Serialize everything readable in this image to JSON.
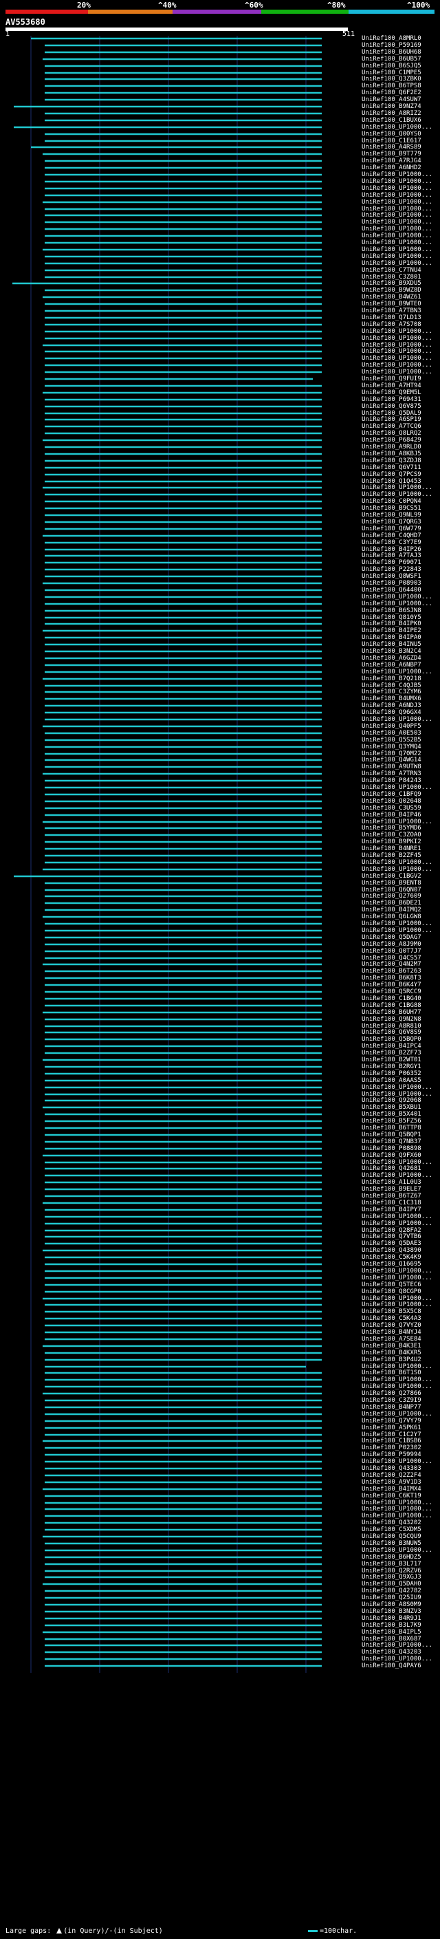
{
  "header": {
    "percent_labels": [
      "20%",
      "^40%",
      "^60%",
      "^80%",
      "^100%"
    ],
    "bar_colors": [
      "#e01818",
      "#e07818",
      "#9030c0",
      "#10b010",
      "#18b8d8"
    ]
  },
  "query": {
    "id": "AV553680",
    "start": "1",
    "end": "511"
  },
  "colors": {
    "hit_line": "#20c8d0",
    "grid": "#1c2e70",
    "background": "#000000"
  },
  "hits": [
    "UniRef100_A8MRL0",
    "UniRef100_P59169",
    "UniRef100_B6UH68",
    "UniRef100_B6UB57",
    "UniRef100_B6SJQ5",
    "UniRef100_C1MPE5",
    "UniRef100_Q3ZBK0",
    "UniRef100_B6TPS8",
    "UniRef100_Q6F2E2",
    "UniRef100_A4SUW7",
    "UniRef100_B9NZ74",
    "UniRef100_A8RIZ2",
    "UniRef100_C1BUX6",
    "UniRef100_UP1000...",
    "UniRef100_Q00YS0",
    "UniRef100_C1E617",
    "UniRef100_A4RS89",
    "UniRef100_B9T779",
    "UniRef100_A7RJG4",
    "UniRef100_A6NHD2",
    "UniRef100_UP1000...",
    "UniRef100_UP1000...",
    "UniRef100_UP1000...",
    "UniRef100_UP1000...",
    "UniRef100_UP1000...",
    "UniRef100_UP1000...",
    "UniRef100_UP1000...",
    "UniRef100_UP1000...",
    "UniRef100_UP1000...",
    "UniRef100_UP1000...",
    "UniRef100_UP1000...",
    "UniRef100_UP1000...",
    "UniRef100_UP1000...",
    "UniRef100_UP1000...",
    "UniRef100_C7TNU4",
    "UniRef100_C3Z801",
    "UniRef100_B9XDU5",
    "UniRef100_B9WZ8D",
    "UniRef100_B4WZ61",
    "UniRef100_B9WTE0",
    "UniRef100_A7TBN3",
    "UniRef100_Q7LD13",
    "UniRef100_A7S708",
    "UniRef100_UP1000...",
    "UniRef100_UP1000...",
    "UniRef100_UP1000...",
    "UniRef100_UP1000...",
    "UniRef100_UP1000...",
    "UniRef100_UP1000...",
    "UniRef100_UP1000...",
    "UniRef100_Q9FUI9",
    "UniRef100_A7HT94",
    "UniRef100_Q9EM5L",
    "UniRef100_P69431",
    "UniRef100_Q6V875",
    "UniRef100_Q5DAL9",
    "UniRef100_A6SP19",
    "UniRef100_A7TCQ6",
    "UniRef100_Q8LRQ2",
    "UniRef100_P68429",
    "UniRef100_A9RLD0",
    "UniRef100_A8KBJ5",
    "UniRef100_Q3ZDJ8",
    "UniRef100_Q6V711",
    "UniRef100_Q7PCS9",
    "UniRef100_Q1Q453",
    "UniRef100_UP1000...",
    "UniRef100_UP1000...",
    "UniRef100_C0PQN4",
    "UniRef100_B9CS51",
    "UniRef100_Q9NL99",
    "UniRef100_Q7QRG3",
    "UniRef100_Q6W779",
    "UniRef100_C4QHD7",
    "UniRef100_C3Y7E9",
    "UniRef100_B4IP26",
    "UniRef100_A7TAJ3",
    "UniRef100_P69071",
    "UniRef100_P22843",
    "UniRef100_Q8WSF1",
    "UniRef100_P08903",
    "UniRef100_Q64400",
    "UniRef100_UP1000...",
    "UniRef100_UP1000...",
    "UniRef100_B6SJN8",
    "UniRef100_Q810Y5",
    "UniRef100_B4IPK0",
    "UniRef100_B4IPE2",
    "UniRef100_B4IPA0",
    "UniRef100_B4INU5",
    "UniRef100_B3N2C4",
    "UniRef100_A6GZD4",
    "UniRef100_A6NBP7",
    "UniRef100_UP1000...",
    "UniRef100_B7Q218",
    "UniRef100_C4QJB5",
    "UniRef100_C3ZYM6",
    "UniRef100_B4UMX6",
    "UniRef100_A6NDJ3",
    "UniRef100_Q96GX4",
    "UniRef100_UP1000...",
    "UniRef100_Q40PF5",
    "UniRef100_A0E503",
    "UniRef100_Q5S2B5",
    "UniRef100_Q3YMQ4",
    "UniRef100_Q70M22",
    "UniRef100_Q4WG14",
    "UniRef100_A9UTW8",
    "UniRef100_A7TRN3",
    "UniRef100_P84243",
    "UniRef100_UP1000...",
    "UniRef100_C1BFQ9",
    "UniRef100_Q02648",
    "UniRef100_C3US59",
    "UniRef100_B4IP46",
    "UniRef100_UP1000...",
    "UniRef100_B5YMD6",
    "UniRef100_C3ZOA0",
    "UniRef100_B9PKI2",
    "UniRef100_B4NRE1",
    "UniRef100_B2ZF45",
    "UniRef100_UP1000...",
    "UniRef100_UP1000...",
    "UniRef100_C1BGV2",
    "UniRef100_B9ENT8",
    "UniRef100_Q6QN07",
    "UniRef100_Q27609",
    "UniRef100_B6DE21",
    "UniRef100_B4IMQ2",
    "UniRef100_Q6LGW8",
    "UniRef100_UP1000...",
    "UniRef100_UP1000...",
    "UniRef100_Q5DAG7",
    "UniRef100_A8J9M0",
    "UniRef100_Q0T7J7",
    "UniRef100_Q4CS57",
    "UniRef100_Q4N2M7",
    "UniRef100_B6T263",
    "UniRef100_B6K8T3",
    "UniRef100_B6K4Y7",
    "UniRef100_Q5RCC9",
    "UniRef100_C1BG40",
    "UniRef100_C1BG88",
    "UniRef100_B6UH77",
    "UniRef100_Q9N2N8",
    "UniRef100_A8R810",
    "UniRef100_Q6V8S9",
    "UniRef100_Q5BQP0",
    "UniRef100_B4IPC4",
    "UniRef100_B2ZF73",
    "UniRef100_B2WT01",
    "UniRef100_B2RGY1",
    "UniRef100_P06352",
    "UniRef100_A0AAS5",
    "UniRef100_UP1000...",
    "UniRef100_UP1000...",
    "UniRef100_Q92068",
    "UniRef100_B5XBU1",
    "UniRef100_B5X401",
    "UniRef100_B5FZ56",
    "UniRef100_B6TTP8",
    "UniRef100_Q5BQP1",
    "UniRef100_Q7NB37",
    "UniRef100_P08898",
    "UniRef100_Q9FX60",
    "UniRef100_UP1000...",
    "UniRef100_Q42681",
    "UniRef100_UP1000...",
    "UniRef100_A1L0U3",
    "UniRef100_B9ELE7",
    "UniRef100_B6TZ67",
    "UniRef100_C1C318",
    "UniRef100_B4IPY7",
    "UniRef100_UP1000...",
    "UniRef100_UP1000...",
    "UniRef100_Q28FA2",
    "UniRef100_Q7VTB6",
    "UniRef100_Q5DAE3",
    "UniRef100_Q43890",
    "UniRef100_C5K4K9",
    "UniRef100_Q16695",
    "UniRef100_UP1000...",
    "UniRef100_UP1000...",
    "UniRef100_Q5TEC6",
    "UniRef100_Q8CGP0",
    "UniRef100_UP1000...",
    "UniRef100_UP1000...",
    "UniRef100_B5X5C8",
    "UniRef100_C5K4A3",
    "UniRef100_Q7VYZ0",
    "UniRef100_B4NYJ4",
    "UniRef100_A7SE84",
    "UniRef100_B4K3E1",
    "UniRef100_B4KXR5",
    "UniRef100_B3P4U2",
    "UniRef100_UP1000...",
    "UniRef100_B6T1S0",
    "UniRef100_UP1000...",
    "UniRef100_UP1000...",
    "UniRef100_Q27866",
    "UniRef100_C3Z9I9",
    "UniRef100_B4NP77",
    "UniRef100_UP1000...",
    "UniRef100_Q7VY79",
    "UniRef100_A5PK61",
    "UniRef100_C1C2Y7",
    "UniRef100_C1BSB6",
    "UniRef100_P02302",
    "UniRef100_P59994",
    "UniRef100_UP1000...",
    "UniRef100_Q43303",
    "UniRef100_Q2Z2F4",
    "UniRef100_A9V1D3",
    "UniRef100_B4IMX4",
    "UniRef100_C6KT19",
    "UniRef100_UP1000...",
    "UniRef100_UP1000...",
    "UniRef100_UP1000...",
    "UniRef100_Q43202",
    "UniRef100_C5XDM5",
    "UniRef100_Q5CQU9",
    "UniRef100_B3NUW5",
    "UniRef100_UP1000...",
    "UniRef100_B6HDZ5",
    "UniRef100_B3L717",
    "UniRef100_Q2RZV6",
    "UniRef100_Q9XGJ3",
    "UniRef100_Q5DAH0",
    "UniRef100_Q42782",
    "UniRef100_Q25IU9",
    "UniRef100_A8S0M9",
    "UniRef100_B3NZV3",
    "UniRef100_B4R9J1",
    "UniRef100_B3L7K9",
    "UniRef100_B4IPL5",
    "UniRef100_B0X687",
    "UniRef100_UP1000...",
    "UniRef100_Q43203",
    "UniRef100_UP1000...",
    "UniRef100_Q4PAY6"
  ],
  "footer": {
    "gap_label": "Large gaps:",
    "query_gap": "(in Query)/",
    "subject_gap": "(in Subject)",
    "scale_label": "=100char."
  }
}
